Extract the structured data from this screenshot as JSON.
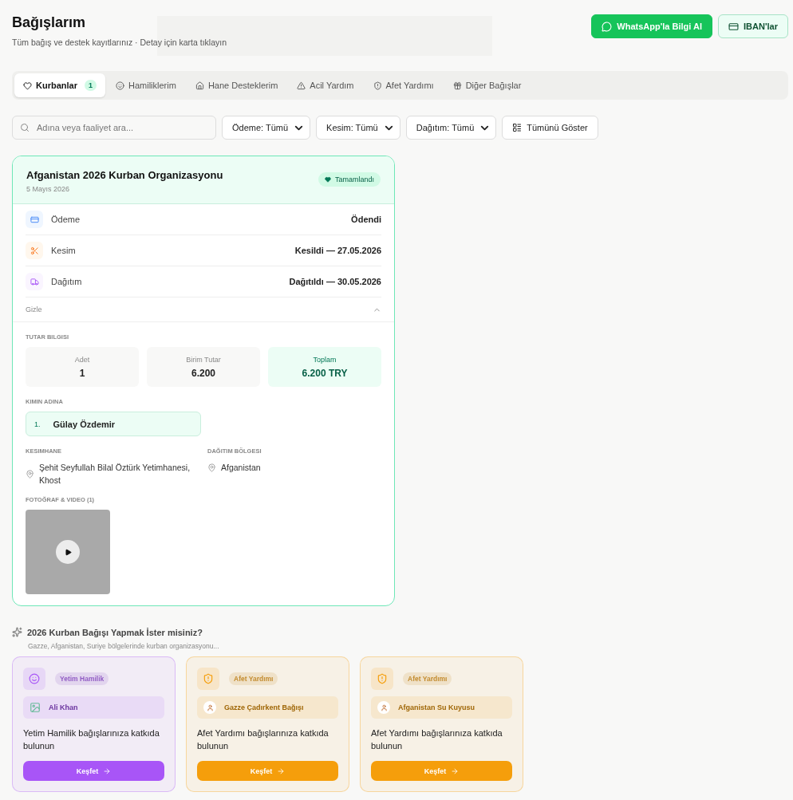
{
  "header": {
    "title": "Bağışlarım",
    "subtitle": "Tüm bağış ve destek kayıtlarınız · Detay için karta tıklayın",
    "buttons": [
      {
        "label": "WhatsApp'la Bilgi Al",
        "kind": "whatsapp"
      },
      {
        "label": "IBAN'lar",
        "kind": "iban"
      }
    ]
  },
  "tabs": [
    {
      "label": "Kurbanlar",
      "kind": "heart",
      "count": "1",
      "selected": true
    },
    {
      "label": "Hamiliklerim",
      "kind": "smile",
      "selected": false
    },
    {
      "label": "Hane Desteklerim",
      "kind": "home",
      "selected": false
    },
    {
      "label": "Acil Yardım",
      "kind": "alert",
      "selected": false
    },
    {
      "label": "Afet Yardımı",
      "kind": "shield",
      "selected": false
    },
    {
      "label": "Diğer Bağışlar",
      "kind": "gift",
      "selected": false
    }
  ],
  "filters": {
    "search": {
      "placeholder": "Adına veya faaliyet ara..."
    },
    "selects": [
      "Ödeme: Tümü",
      "Kesim: Tümü",
      "Dağıtım: Tümü"
    ],
    "show_all": "Tümünü Göster"
  },
  "card": {
    "title": "Afganistan 2026 Kurban Organizasyonu",
    "date": "5 Mayıs 2026",
    "status": "Tamamlandı",
    "rows": [
      {
        "kind": "payment",
        "label": "Ödeme",
        "value": "Ödendi"
      },
      {
        "kind": "cut",
        "label": "Kesim",
        "value": "Kesildi — 27.05.2026"
      },
      {
        "kind": "distribution",
        "label": "Dağıtım",
        "value": "Dağıtıldı — 30.05.2026"
      }
    ],
    "toggle": {
      "label": "Gizle",
      "expanded": true
    },
    "amount_title": "TUTAR BILGISI",
    "amounts": [
      {
        "label": "Adet",
        "value": "1",
        "kind": "plain"
      },
      {
        "label": "Birim Tutar",
        "value": "6.200",
        "kind": "plain"
      },
      {
        "label": "Toplam",
        "value": "6.200 TRY",
        "kind": "total"
      }
    ],
    "names_title": "KIMIN ADINA",
    "names": [
      {
        "index": "1.",
        "name": "Gülay Özdemir"
      }
    ],
    "places": [
      {
        "title": "KESIMHANE",
        "value": "Şehit Seyfullah Bilal Öztürk Yetimhanesi, Khost"
      },
      {
        "title": "DAĞITIM BÖLGESI",
        "value": "Afganistan"
      }
    ],
    "media_title": "FOTOĞRAF & VIDEO (1)",
    "media": [
      {
        "kind": "video"
      }
    ]
  },
  "suggest": {
    "title": "2026 Kurban Bağışı Yapmak İster misiniz?",
    "subtitle": "Gazze, Afganistan, Suriye bölgelerinde kurban organizasyonu...",
    "cards": [
      {
        "color": "#a855f7",
        "kind": "smile",
        "tag": "Yetim Hamilik",
        "person": {
          "name": "Ali Khan",
          "kind": "photo"
        },
        "text": "Yetim Hamilik bağışlarınıza katkıda bulunun",
        "button": "Keşfet"
      },
      {
        "color": "#f59e0b",
        "kind": "shield",
        "tag": "Afet Yardımı",
        "person": {
          "name": "Gazze Çadırkent Bağışı",
          "kind": "user"
        },
        "text": "Afet Yardımı bağışlarınıza katkıda bulunun",
        "button": "Keşfet"
      },
      {
        "color": "#f59e0b",
        "kind": "shield",
        "tag": "Afet Yardımı",
        "person": {
          "name": "Afganistan Su Kuyusu",
          "kind": "user"
        },
        "text": "Afet Yardımı bağışlarınıza katkıda bulunun",
        "button": "Keşfet"
      }
    ]
  }
}
